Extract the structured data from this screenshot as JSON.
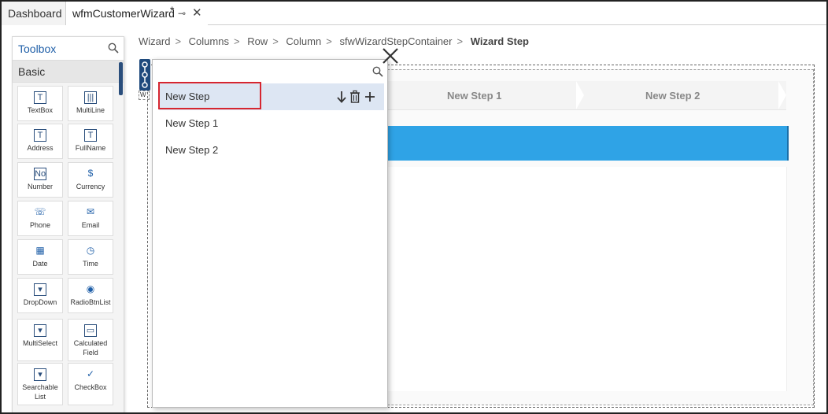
{
  "tabs": {
    "dashboard": "Dashboard",
    "active": "wfmCustomerWizard",
    "modified_marker": "*"
  },
  "toolbox": {
    "title": "Toolbox",
    "section": "Basic",
    "items": [
      {
        "label": "TextBox",
        "icon": "textbox-icon",
        "glyph": "T"
      },
      {
        "label": "MultiLine",
        "icon": "multiline-icon",
        "glyph": "|||"
      },
      {
        "label": "Address",
        "icon": "address-icon",
        "glyph": "T"
      },
      {
        "label": "FullName",
        "icon": "fullname-icon",
        "glyph": "T"
      },
      {
        "label": "Number",
        "icon": "number-icon",
        "glyph": "No"
      },
      {
        "label": "Currency",
        "icon": "currency-icon",
        "glyph": "$"
      },
      {
        "label": "Phone",
        "icon": "phone-icon",
        "glyph": "☏"
      },
      {
        "label": "Email",
        "icon": "email-icon",
        "glyph": "✉"
      },
      {
        "label": "Date",
        "icon": "calendar-icon",
        "glyph": "▦"
      },
      {
        "label": "Time",
        "icon": "clock-icon",
        "glyph": "◷"
      },
      {
        "label": "DropDown",
        "icon": "dropdown-icon",
        "glyph": "▾"
      },
      {
        "label": "RadioBtnList",
        "icon": "radio-icon",
        "glyph": "◉"
      },
      {
        "label": "MultiSelect",
        "icon": "multiselect-icon",
        "glyph": "▾"
      },
      {
        "label": "Calculated Field",
        "icon": "calculated-field-icon",
        "glyph": "▭"
      },
      {
        "label": "Searchable List",
        "icon": "searchable-list-icon",
        "glyph": "▾"
      },
      {
        "label": "CheckBox",
        "icon": "checkbox-icon",
        "glyph": "✓"
      }
    ]
  },
  "breadcrumb": {
    "items": [
      "Wizard",
      "Columns",
      "Row",
      "Column",
      "sfwWizardStepContainer"
    ],
    "current": "Wizard Step",
    "separator": ">"
  },
  "canvas": {
    "steps": [
      "New Step 1",
      "New Step 2"
    ],
    "accent_color": "#2fa3e6",
    "mini_label": "W"
  },
  "popup": {
    "steps": [
      "New Step",
      "New Step 1",
      "New Step 2"
    ],
    "selected_index": 0,
    "highlight_color": "#d62630"
  }
}
